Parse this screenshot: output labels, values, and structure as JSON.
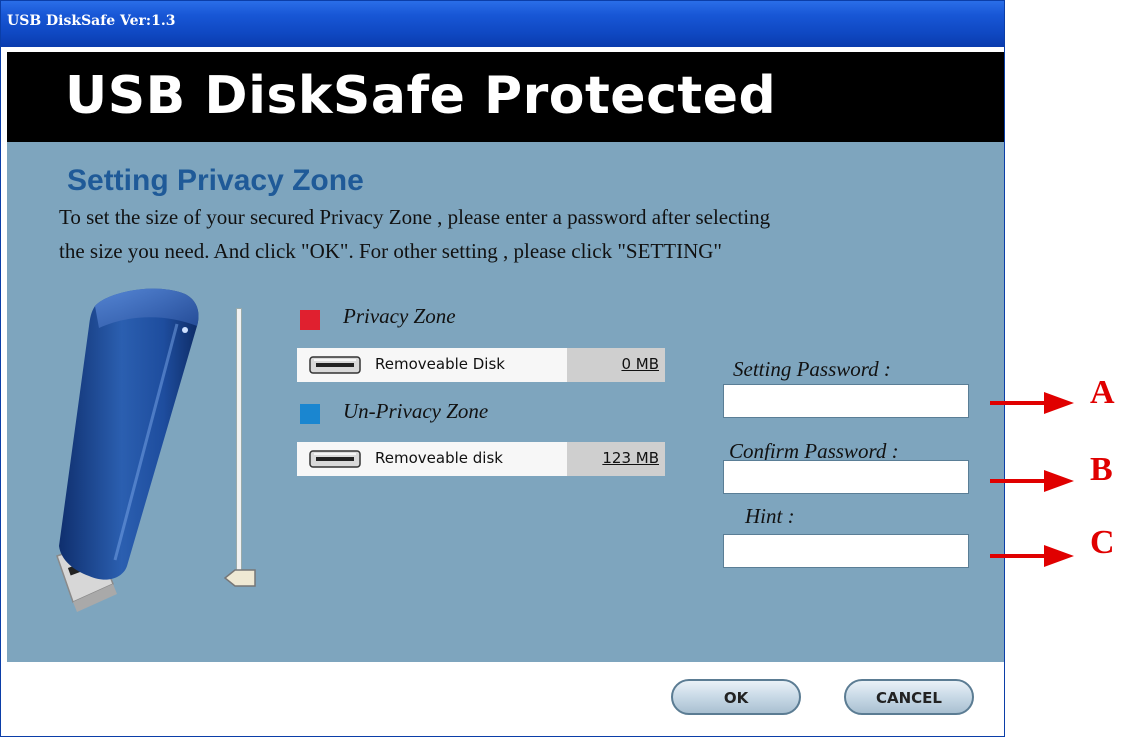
{
  "window": {
    "title": "USB DiskSafe Ver:1.3"
  },
  "banner": {
    "text": "USB DiskSafe Protected"
  },
  "section": {
    "title": "Setting Privacy Zone",
    "description_line1": "To set the size of your secured Privacy Zone , please enter a password after selecting",
    "description_line2": "the size you need. And click \"OK\". For other setting , please click \"SETTING\""
  },
  "zones": {
    "privacy": {
      "label": "Privacy Zone",
      "color": "#e0202f",
      "disk_name": "Removeable Disk",
      "size": "0 MB"
    },
    "unprivacy": {
      "label": "Un-Privacy Zone",
      "color": "#1a86d0",
      "disk_name": "Removeable disk",
      "size": "123 MB"
    }
  },
  "fields": {
    "setting_password": {
      "label": "Setting Password :",
      "value": ""
    },
    "confirm_password": {
      "label": "Confirm Password :",
      "value": ""
    },
    "hint": {
      "label": "Hint :",
      "value": ""
    }
  },
  "slider": {
    "level": 0
  },
  "buttons": {
    "ok": "OK",
    "cancel": "CANCEL"
  },
  "annotations": {
    "a": "A",
    "b": "B",
    "c": "C",
    "color": "#e00000"
  },
  "icons": {
    "usb": "usb-drive-icon",
    "disk": "removable-disk-icon",
    "arrow": "red-arrow-icon"
  }
}
